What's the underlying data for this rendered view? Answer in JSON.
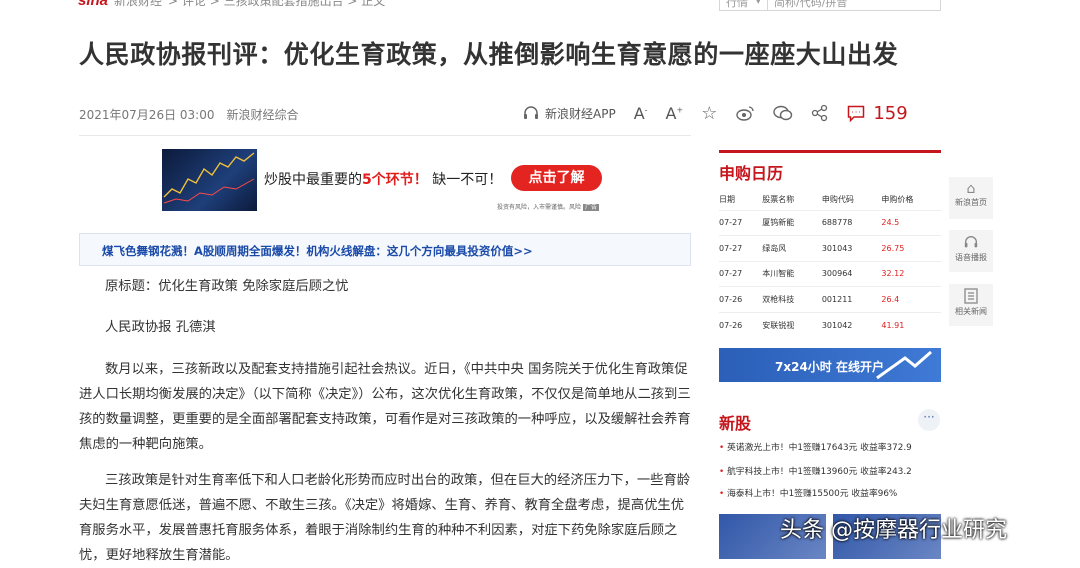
{
  "header": {
    "logo": "sina",
    "site": "新浪财经",
    "crumbs": "> 评论 > 三孩政策配套措施出台 > 正文"
  },
  "search": {
    "select": "行情",
    "placeholder": "简称/代码/拼音"
  },
  "article": {
    "title": "人民政协报刊评：优化生育政策，从推倒影响生育意愿的一座座大山出发",
    "date": "2021年07月26日 03:00",
    "source": "新浪财经综合",
    "app": "新浪财经APP",
    "comments": "159",
    "paragraphs": [
      "原标题：优化生育政策 免除家庭后顾之忧",
      "人民政协报 孔德淇",
      "数月以来，三孩新政以及配套支持措施引起社会热议。近日，《中共中央 国务院关于优化生育政策促进人口长期均衡发展的决定》（以下简称《决定》）公布，这次优化生育政策，不仅仅是简单地从二孩到三孩的数量调整，更重要的是全面部署配套支持政策，可看作是对三孩政策的一种呼应，以及缓解社会养育焦虑的一种靶向施策。",
      "三孩政策是针对生育率低下和人口老龄化形势而应时出台的政策，但在巨大的经济压力下，一些育龄夫妇生育意愿低迷，普遍不愿、不敢生三孩。《决定》将婚嫁、生育、养育、教育全盘考虑，提高优生优育服务水平，发展普惠托育服务体系，着眼于消除制约生育的种种不利因素，对症下药免除家庭后顾之忧，更好地释放生育潜能。"
    ]
  },
  "ad": {
    "text_a": "炒股中最重要的",
    "text_red": "5个环节！",
    "text_b": "缺一不可！",
    "button": "点击了解",
    "note": "投资有风险，入市需谨慎。风险"
  },
  "banner": {
    "text": "煤飞色舞钢花溅！A股顺周期全面爆发！机构火线解盘：这几个方向最具投资价值>>"
  },
  "ipo_calendar": {
    "title": "申购日历",
    "headers": [
      "日期",
      "股票名称",
      "申购代码",
      "申购价格"
    ],
    "rows": [
      [
        "07-27",
        "厦钨新能",
        "688778",
        "24.5"
      ],
      [
        "07-27",
        "绿岛风",
        "301043",
        "26.75"
      ],
      [
        "07-27",
        "本川智能",
        "300964",
        "32.12"
      ],
      [
        "07-26",
        "双枪科技",
        "001211",
        "26.4"
      ],
      [
        "07-26",
        "安联锐视",
        "301042",
        "41.91"
      ]
    ]
  },
  "kaihu": {
    "text": "7x24小时 在线开户"
  },
  "newshares": {
    "title": "新股",
    "items": [
      {
        "text": "英诺激光上市！中1签赚17643元 收益率372.9"
      },
      {
        "text": "航宇科技上市！中1签赚13960元 收益率243.2"
      },
      {
        "text": "海泰科上市！中1签赚15500元 收益率96%"
      }
    ]
  },
  "rail": [
    {
      "icon": "home-icon",
      "label": "新浪首页"
    },
    {
      "icon": "headphones-icon",
      "label": "语音播报"
    },
    {
      "icon": "document-icon",
      "label": "相关新闻"
    }
  ],
  "watermark": "头条 @按摩器行业研究"
}
